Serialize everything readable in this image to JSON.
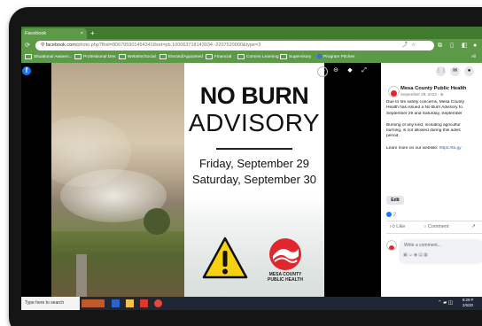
{
  "browser": {
    "tab_title": "Facebook",
    "tab_close": "×",
    "new_tab": "+",
    "url_host": "facebook.com",
    "url_path": "/photo.php?fbid=8067959014543418set=pb.100063718143034.-2207520000&type=3",
    "nav_back": "⟳",
    "bookmarks": [
      {
        "label": "Situational Awaren...",
        "kind": "folder"
      },
      {
        "label": "Professional Dev.",
        "kind": "folder"
      },
      {
        "label": "Website/Social",
        "kind": "folder"
      },
      {
        "label": "Elected/Appointed",
        "kind": "folder"
      },
      {
        "label": "Financial",
        "kind": "folder"
      },
      {
        "label": "Comms Learning",
        "kind": "folder"
      },
      {
        "label": "Supervisory",
        "kind": "folder"
      },
      {
        "label": "Program Pitches",
        "kind": "page"
      }
    ],
    "bookmarks_more": "All"
  },
  "poster": {
    "headline_line1": "NO BURN",
    "headline_line2": "ADVISORY",
    "date_line1": "Friday, September 29",
    "date_line2": "Saturday, September 30",
    "logo_line1": "MESA COUNTY",
    "logo_line2": "PUBLIC HEALTH",
    "accent_red": "#e1272d",
    "warning_yellow": "#f6d110"
  },
  "post": {
    "page_name": "Mesa County Public Health",
    "date": "September 29, 2023 · ",
    "paragraph1": [
      "Due to fire safety concerns, Mesa County",
      "Health has issued a No Burn Advisory fo",
      "September 29 and Saturday, September"
    ],
    "paragraph2": [
      "Burning of any kind, including agricultur",
      "burning, is not allowed during this advis",
      "period."
    ],
    "learn_more_prefix": "Learn more on our website: ",
    "learn_more_link": "https://tb.gy",
    "edit_label": "Edit",
    "reaction_count": "2",
    "like_label": "Like",
    "comment_label": "Comment",
    "comment_placeholder": "Write a comment..."
  },
  "taskbar": {
    "search_placeholder": "Type here to search",
    "time": "8:29 P",
    "date": "2/6/20"
  },
  "colors": {
    "browser_green": "#5c9a48",
    "fb_blue": "#1877f2"
  }
}
